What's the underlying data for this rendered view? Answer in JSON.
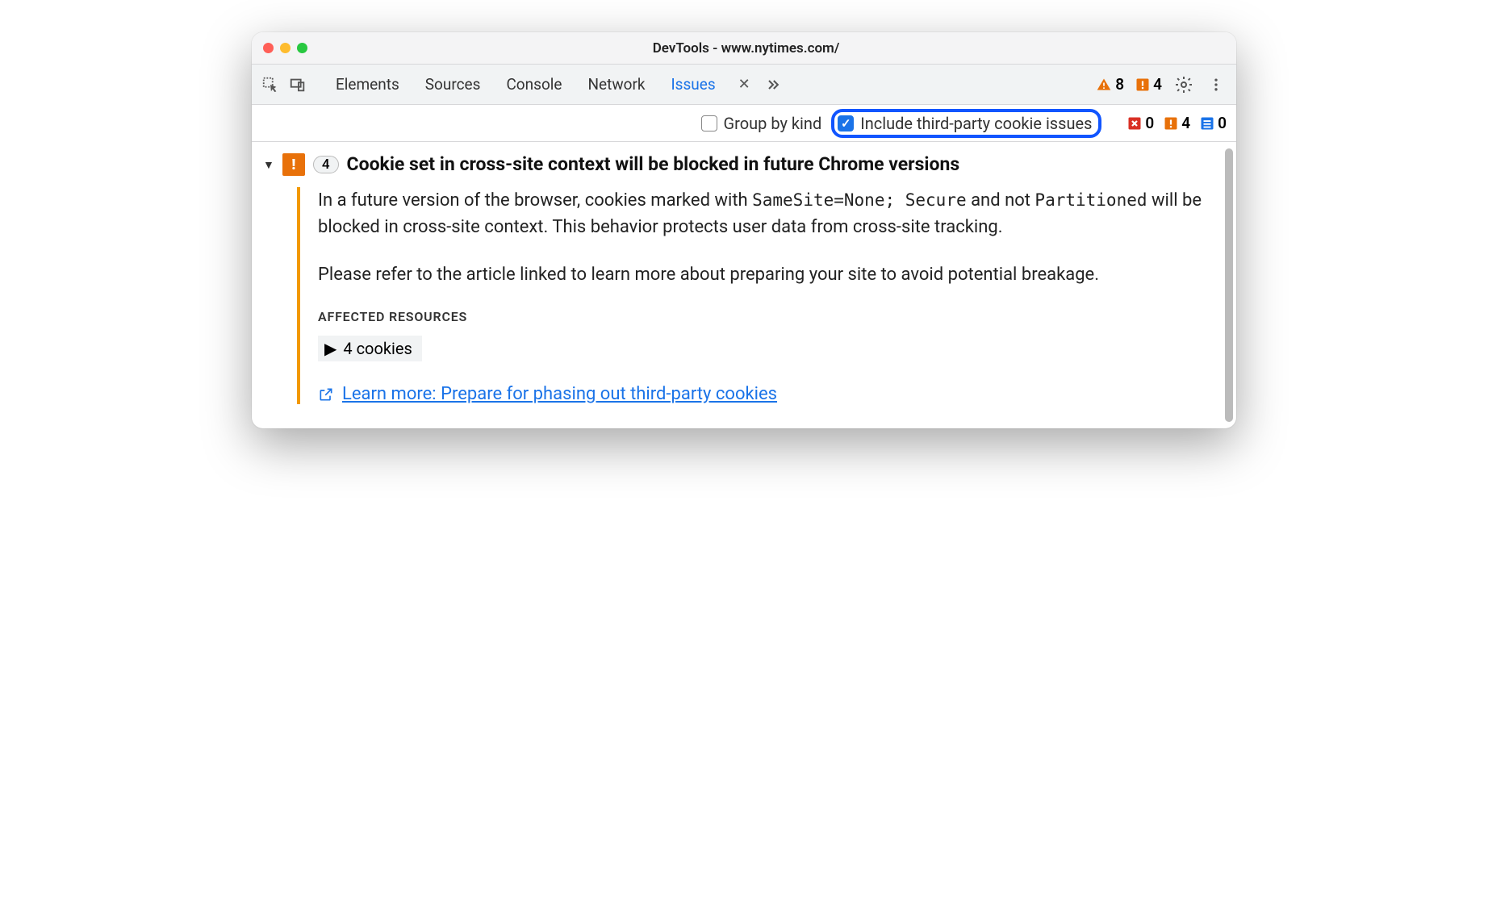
{
  "window": {
    "title": "DevTools - www.nytimes.com/"
  },
  "tabs": {
    "items": [
      "Elements",
      "Sources",
      "Console",
      "Network",
      "Issues"
    ],
    "active": "Issues"
  },
  "tabbar_counts": {
    "warnings": "8",
    "issues": "4"
  },
  "filter": {
    "group_by_kind": {
      "label": "Group by kind",
      "checked": false
    },
    "include_tpc": {
      "label": "Include third-party cookie issues",
      "checked": true
    },
    "counts": {
      "errors": "0",
      "issues": "4",
      "info": "0"
    }
  },
  "issue": {
    "count": "4",
    "title": "Cookie set in cross-site context will be blocked in future Chrome versions",
    "body_part1": "In a future version of the browser, cookies marked with ",
    "code1": "SameSite=None; Secure",
    "body_part2": " and not ",
    "code2": "Partitioned",
    "body_part3": " will be blocked in cross-site context. This behavior protects user data from cross-site tracking.",
    "body2": "Please refer to the article linked to learn more about preparing your site to avoid potential breakage.",
    "affected_heading": "AFFECTED RESOURCES",
    "affected_item": "4 cookies",
    "learn_more": "Learn more: Prepare for phasing out third-party cookies"
  }
}
